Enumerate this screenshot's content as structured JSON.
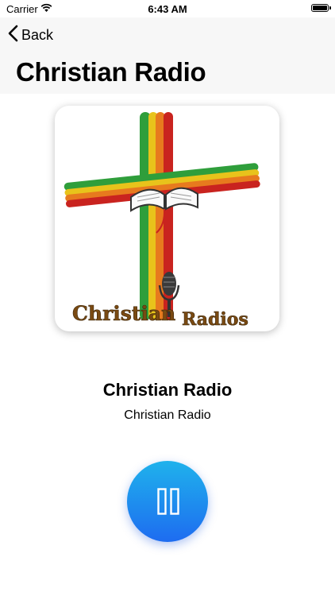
{
  "status_bar": {
    "carrier": "Carrier",
    "time": "6:43 AM"
  },
  "nav": {
    "back_label": "Back",
    "title": "Christian Radio"
  },
  "artwork": {
    "logo_text_left": "Christian",
    "logo_text_right": "Radios"
  },
  "player": {
    "station_name": "Christian Radio",
    "station_subtitle": "Christian Radio",
    "state": "playing",
    "button_icon": "pause-icon"
  },
  "colors": {
    "accent_top": "#1fb2ec",
    "accent_bottom": "#1e6cf0"
  }
}
